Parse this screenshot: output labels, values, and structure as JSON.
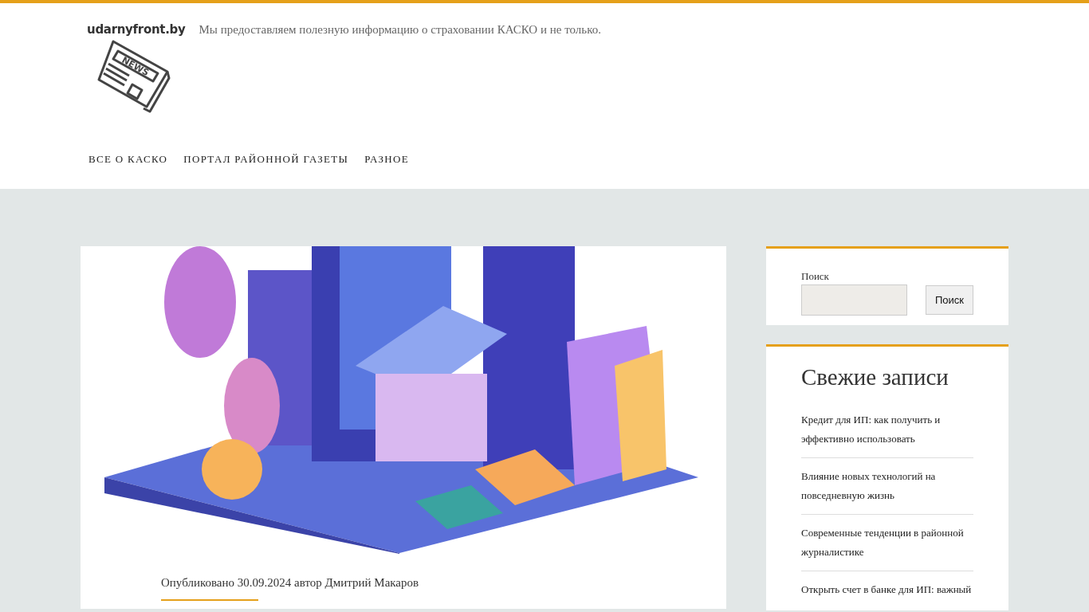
{
  "site": {
    "title": "udarnyfront.by",
    "tagline": "Мы предоставляем полезную информацию о страховании КАСКО и не только.",
    "logo_text": "NEWS"
  },
  "nav": [
    {
      "label": "ВСЕ О КАСКО"
    },
    {
      "label": "ПОРТАЛ РАЙОННОЙ ГАЗЕТЫ"
    },
    {
      "label": "РАЗНОЕ"
    }
  ],
  "post": {
    "meta": "Опубликовано 30.09.2024 автор Дмитрий Макаров"
  },
  "sidebar": {
    "search": {
      "label": "Поиск",
      "button": "Поиск"
    },
    "recent": {
      "title": "Свежие записи",
      "items": [
        {
          "title": "Кредит для ИП: как получить и эффективно использовать"
        },
        {
          "title": "Влияние новых технологий на повседневную жизнь"
        },
        {
          "title": "Современные тенденции в районной журналистике"
        },
        {
          "title": "Открыть счет в банке для ИП: важный"
        }
      ]
    }
  }
}
